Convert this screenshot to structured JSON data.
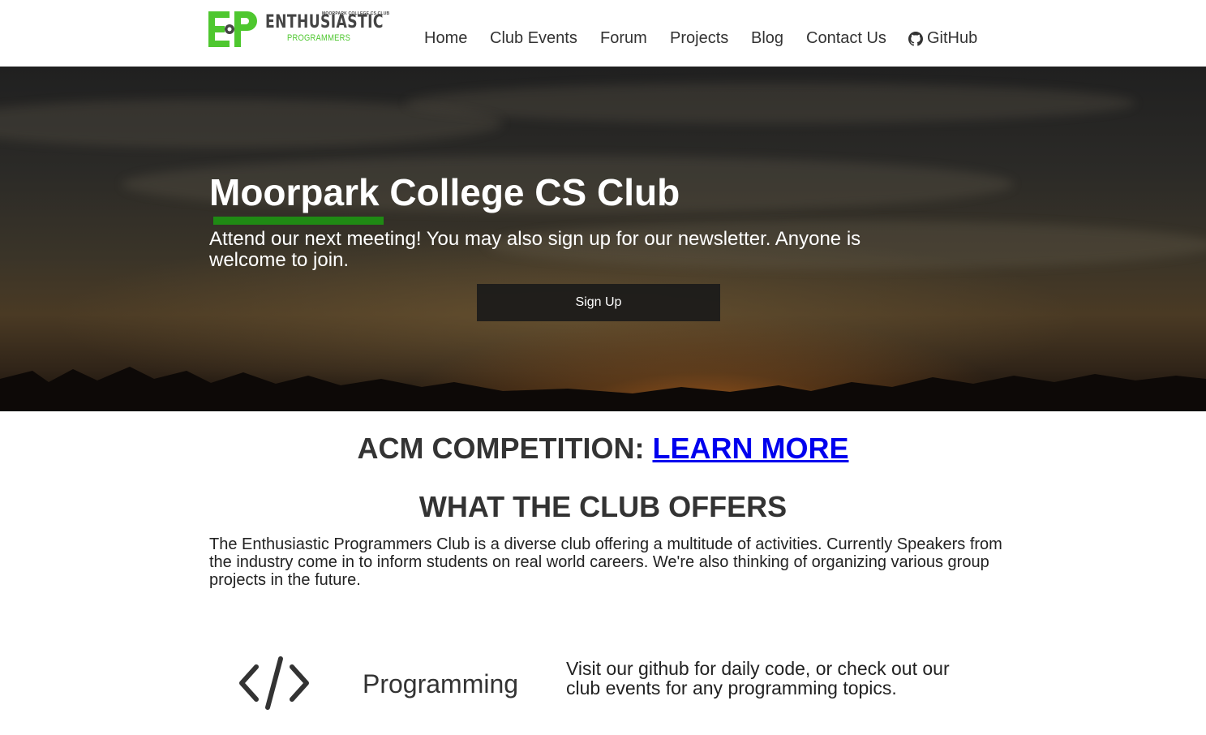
{
  "brand": {
    "mark": "EP",
    "small_text": "MOORPARK COLLEGE CS CLUB",
    "name": "ENTHUSIASTIC",
    "sub": "PROGRAMMERS",
    "colors": {
      "green": "#4ec72f",
      "dark": "#444444"
    }
  },
  "nav": {
    "items": [
      {
        "label": "Home"
      },
      {
        "label": "Club Events"
      },
      {
        "label": "Forum"
      },
      {
        "label": "Projects"
      },
      {
        "label": "Blog"
      },
      {
        "label": "Contact Us"
      },
      {
        "label": "GitHub",
        "icon": "github-icon"
      }
    ]
  },
  "hero": {
    "title": "Moorpark College CS Club",
    "text": "Attend our next meeting! You may also sign up for our newsletter. Anyone is welcome to join.",
    "button": "Sign Up",
    "accent": "#1f8a14"
  },
  "acm": {
    "label": "ACM COMPETITION: ",
    "link": "LEARN MORE"
  },
  "offers": {
    "title": "WHAT THE CLUB OFFERS",
    "text": "The Enthusiastic Programmers Club is a diverse club offering a multitude of activities. Currently Speakers from the industry come in to inform students on real world careers. We're also thinking of organizing various group projects in the future."
  },
  "feature": {
    "icon": "code-icon",
    "title": "Programming",
    "text": "Visit our github for daily code, or check out our club events for any programming topics."
  }
}
